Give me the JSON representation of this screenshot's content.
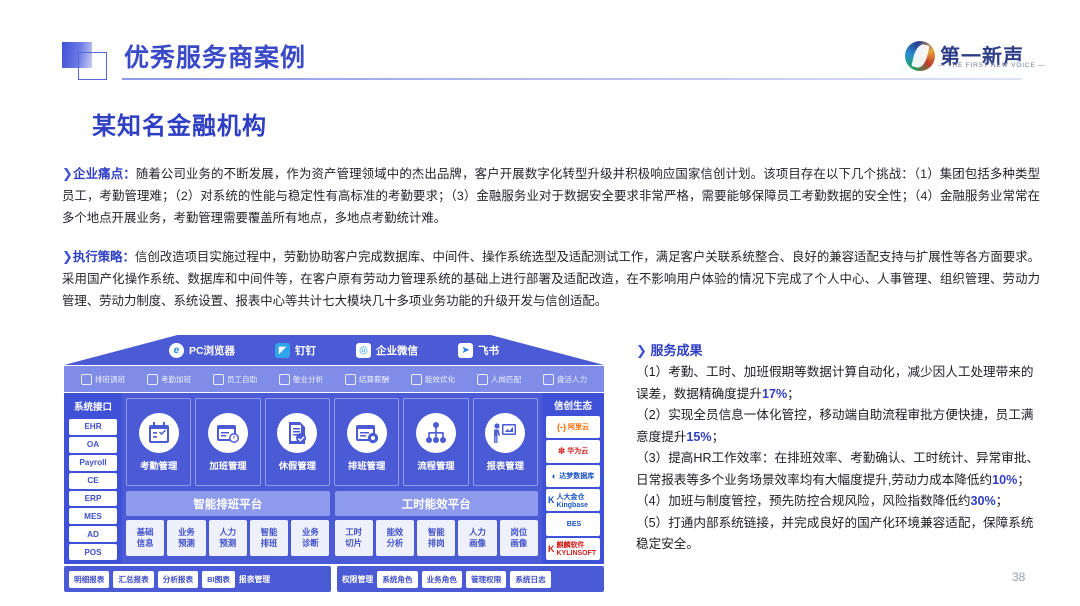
{
  "header": {
    "title": "优秀服务商案例",
    "logo_cn": "第一新声",
    "logo_en": "— THE FIRST NEW VOICE —"
  },
  "subtitle": "某知名金融机构",
  "paragraphs": [
    {
      "arrow": "❯",
      "lead": "企业痛点：",
      "text": "随着公司业务的不断发展，作为资产管理领域中的杰出品牌，客户开展数字化转型升级并积极响应国家信创计划。该项目存在以下几个挑战：（1）集团包括多种类型员工，考勤管理难；（2）对系统的性能与稳定性有高标准的考勤要求；（3）金融服务业对于数据安全要求非常严格，需要能够保障员工考勤数据的安全性；（4）金融服务业常常在多个地点开展业务，考勤管理需要覆盖所有地点，多地点考勤统计难。"
    },
    {
      "arrow": "❯",
      "lead": "执行策略：",
      "text": "信创改造项目实施过程中，劳勤协助客户完成数据库、中间件、操作系统选型及适配测试工作，满足客户关联系统整合、良好的兼容适配支持与扩展性等各方面要求。采用国产化操作系统、数据库和中间件等，在客户原有劳动力管理系统的基础上进行部署及适配改造，在不影响用户体验的情况下完成了个人中心、人事管理、组织管理、劳动力管理、劳动力制度、系统设置、报表中心等共计七大模块几十多项业务功能的升级开发与信创适配。"
    }
  ],
  "diagram": {
    "clients": [
      {
        "icon": "ie-browser-icon",
        "glyph": "e",
        "label": "PC浏览器"
      },
      {
        "icon": "dingtalk-icon",
        "glyph": "◤",
        "label": "钉钉"
      },
      {
        "icon": "wecom-icon",
        "glyph": "◎",
        "label": "企业微信"
      },
      {
        "icon": "feishu-icon",
        "glyph": "➤",
        "label": "飞书"
      }
    ],
    "scenarios": [
      {
        "icon": "clipboard-icon",
        "label": "排班调班"
      },
      {
        "icon": "user-clock-icon",
        "label": "考勤加班"
      },
      {
        "icon": "mobile-icon",
        "label": "员工自助"
      },
      {
        "icon": "document-icon",
        "label": "敬业分析"
      },
      {
        "icon": "funnel-icon",
        "label": "结算薪酬"
      },
      {
        "icon": "bar-chart-icon",
        "label": "能效优化"
      },
      {
        "icon": "match-icon",
        "label": "人岗匹配"
      },
      {
        "icon": "people-icon",
        "label": "盘活人力"
      }
    ],
    "interfaces": {
      "title": "系统接口",
      "items": [
        "EHR",
        "OA",
        "Payroll",
        "CE",
        "ERP",
        "MES",
        "AD",
        "POS"
      ]
    },
    "modules": [
      {
        "icon": "calendar-check-icon",
        "label": "考勤管理"
      },
      {
        "icon": "calendar-clock-icon",
        "label": "加班管理"
      },
      {
        "icon": "doc-check-icon",
        "label": "休假管理"
      },
      {
        "icon": "calendar-gear-icon",
        "label": "排班管理"
      },
      {
        "icon": "flow-tree-icon",
        "label": "流程管理"
      },
      {
        "icon": "presentation-icon",
        "label": "报表管理"
      }
    ],
    "platforms": [
      {
        "name": "智能排班平台",
        "tiles": [
          "基础\n信息",
          "业务\n预测",
          "人力\n预测",
          "智能\n排班",
          "业务\n诊断"
        ]
      },
      {
        "name": "工时能效平台",
        "tiles": [
          "工时\n切片",
          "能效\n分析",
          "智能\n排岗",
          "人力\n画像",
          "岗位\n画像"
        ]
      }
    ],
    "ecosystem": {
      "title": "信创生态",
      "items": [
        {
          "mark": "(-)",
          "name": "阿里云",
          "color": "#ff6a00"
        },
        {
          "mark": "✽",
          "name": "华为云",
          "color": "#d1211c"
        },
        {
          "mark": "◐",
          "name": "达梦数据库",
          "color": "#1a56c4"
        },
        {
          "mark": "K",
          "name": "人大金仓 Kingbase",
          "color": "#1a56c4"
        },
        {
          "mark": "",
          "name": "BES",
          "color": "#1a4fc2"
        },
        {
          "mark": "K",
          "name": "麒麟软件 KYLINSOFT",
          "color": "#d1211c"
        }
      ]
    },
    "bottom": [
      {
        "label": "报表管理",
        "chips": [
          "明细报表",
          "汇总报表",
          "分析报表",
          "BI图表"
        ]
      },
      {
        "label": "权限管理",
        "chips": [
          "系统角色",
          "业务角色",
          "管理权限",
          "系统日志"
        ]
      }
    ]
  },
  "results": {
    "arrow": "❯",
    "title": "服务成果",
    "items": [
      {
        "pre": "（1）考勤、工时、加班假期等数据计算自动化，减少因人工处理带来的误差，数据精确度提升",
        "hl": "17%",
        "post": "；"
      },
      {
        "pre": "（2）实现全员信息一体化管控，移动端自助流程审批方便快捷，员工满意度提升",
        "hl": "15%",
        "post": "；"
      },
      {
        "pre": "（3）提高HR工作效率：在排班效率、考勤确认、工时统计、异常审批、日常报表等多个业务场景效率均有大幅度提升,劳动力成本降低约",
        "hl": "10%",
        "post": "；"
      },
      {
        "pre": "（4）加班与制度管控，预先防控合规风险，风险指数降低约",
        "hl": "30%",
        "post": "；"
      },
      {
        "pre": "（5）打通内部系统链接，并完成良好的国产化环境兼容适配，保障系统稳定安全。",
        "hl": "",
        "post": ""
      }
    ]
  },
  "page_number": "38",
  "colors": {
    "primary": "#3f51d6",
    "card": "#4b5bd6",
    "light": "#8e9bec",
    "tile": "#eef0fc"
  }
}
